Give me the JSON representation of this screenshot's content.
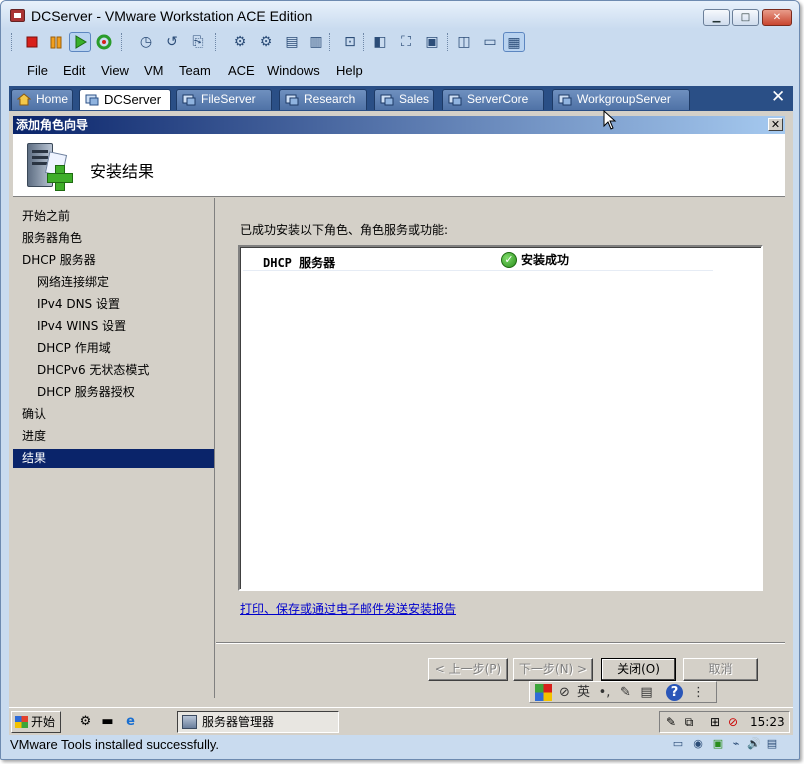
{
  "window": {
    "title": "DCServer - VMware Workstation ACE Edition",
    "controls": {
      "minimize": "▁",
      "maximize": "□",
      "close": "✕"
    }
  },
  "menu": [
    "File",
    "Edit",
    "View",
    "VM",
    "Team",
    "ACE",
    "Windows",
    "Help"
  ],
  "tabs": [
    {
      "label": "Home",
      "icon": "home-icon"
    },
    {
      "label": "DCServer",
      "icon": "vm-icon",
      "active": true
    },
    {
      "label": "FileServer",
      "icon": "vm-icon"
    },
    {
      "label": "Research",
      "icon": "vm-icon"
    },
    {
      "label": "Sales",
      "icon": "vm-icon"
    },
    {
      "label": "ServerCore",
      "icon": "vm-icon"
    },
    {
      "label": "WorkgroupServer",
      "icon": "vm-icon"
    }
  ],
  "tabbar_close": "✕",
  "wizard": {
    "title": "添加角色向导",
    "close": "✕",
    "heading": "安装结果",
    "nav": [
      {
        "label": "开始之前",
        "indent": 0
      },
      {
        "label": "服务器角色",
        "indent": 0
      },
      {
        "label": "DHCP 服务器",
        "indent": 0
      },
      {
        "label": "网络连接绑定",
        "indent": 1
      },
      {
        "label": "IPv4 DNS 设置",
        "indent": 1
      },
      {
        "label": "IPv4 WINS 设置",
        "indent": 1
      },
      {
        "label": "DHCP 作用域",
        "indent": 1
      },
      {
        "label": "DHCPv6 无状态模式",
        "indent": 1
      },
      {
        "label": "DHCP 服务器授权",
        "indent": 1
      },
      {
        "label": "确认",
        "indent": 0
      },
      {
        "label": "进度",
        "indent": 0
      },
      {
        "label": "结果",
        "indent": 0,
        "selected": true
      }
    ],
    "intro": "已成功安装以下角色、角色服务或功能:",
    "results": [
      {
        "name": "DHCP 服务器",
        "status": "安装成功",
        "status_icon": "check-icon",
        "status_glyph": "✓"
      }
    ],
    "report_link": "打印、保存或通过电子邮件发送安装报告",
    "buttons": {
      "prev": "< 上一步(P)",
      "next": "下一步(N) >",
      "close": "关闭(O)",
      "cancel": "取消"
    },
    "langbar": {
      "lang": "英"
    }
  },
  "taskbar": {
    "start": "开始",
    "task": "服务器管理器",
    "clock": "15:23"
  },
  "status": {
    "text": "VMware Tools installed successfully."
  },
  "colors": {
    "nav_selected": "#0a246a",
    "wizard_title_start": "#0a246a",
    "wizard_title_end": "#a6caf0",
    "vmware_tabbar": "#2a4f86",
    "link": "#0000cc",
    "success": "#2a8e1c"
  }
}
